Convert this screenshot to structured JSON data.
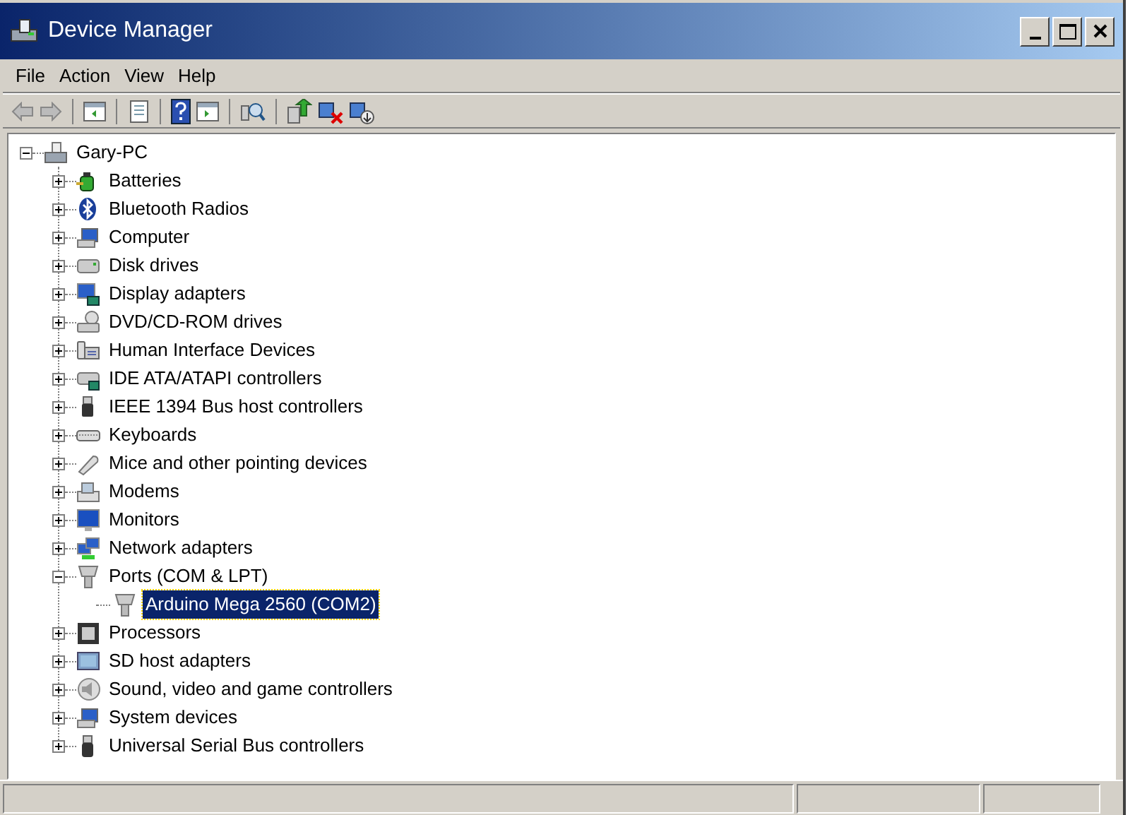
{
  "window": {
    "title": "Device Manager"
  },
  "menu": [
    "File",
    "Action",
    "View",
    "Help"
  ],
  "tree": {
    "label": "Gary-PC",
    "expanded": true,
    "selected": false,
    "children": [
      {
        "label": "Batteries",
        "expanded": false,
        "selected": false
      },
      {
        "label": "Bluetooth Radios",
        "expanded": false,
        "selected": false
      },
      {
        "label": "Computer",
        "expanded": false,
        "selected": false
      },
      {
        "label": "Disk drives",
        "expanded": false,
        "selected": false
      },
      {
        "label": "Display adapters",
        "expanded": false,
        "selected": false
      },
      {
        "label": "DVD/CD-ROM drives",
        "expanded": false,
        "selected": false
      },
      {
        "label": "Human Interface Devices",
        "expanded": false,
        "selected": false
      },
      {
        "label": "IDE ATA/ATAPI controllers",
        "expanded": false,
        "selected": false
      },
      {
        "label": "IEEE 1394 Bus host controllers",
        "expanded": false,
        "selected": false
      },
      {
        "label": "Keyboards",
        "expanded": false,
        "selected": false
      },
      {
        "label": "Mice and other pointing devices",
        "expanded": false,
        "selected": false
      },
      {
        "label": "Modems",
        "expanded": false,
        "selected": false
      },
      {
        "label": "Monitors",
        "expanded": false,
        "selected": false
      },
      {
        "label": "Network adapters",
        "expanded": false,
        "selected": false
      },
      {
        "label": "Ports (COM & LPT)",
        "expanded": true,
        "selected": false,
        "children": [
          {
            "label": "Arduino Mega 2560 (COM2)",
            "selected": true
          }
        ]
      },
      {
        "label": "Processors",
        "expanded": false,
        "selected": false
      },
      {
        "label": "SD host adapters",
        "expanded": false,
        "selected": false
      },
      {
        "label": "Sound, video and game controllers",
        "expanded": false,
        "selected": false
      },
      {
        "label": "System devices",
        "expanded": false,
        "selected": false
      },
      {
        "label": "Universal Serial Bus controllers",
        "expanded": false,
        "selected": false
      }
    ]
  }
}
